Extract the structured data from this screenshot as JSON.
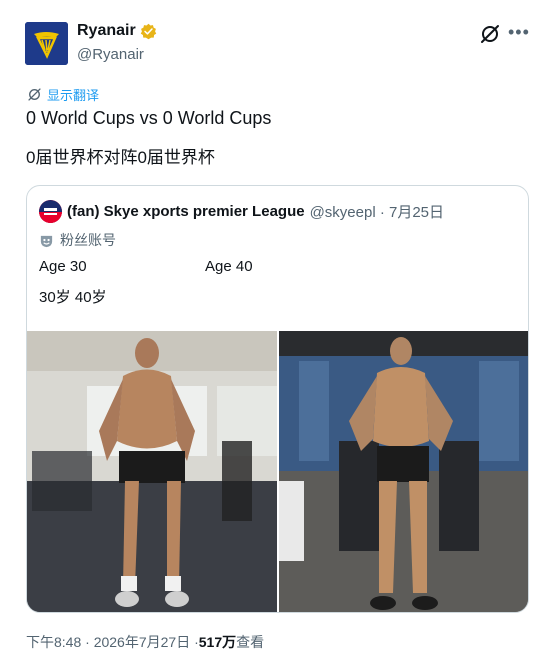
{
  "author": {
    "display_name": "Ryanair",
    "handle": "@Ryanair"
  },
  "translate_label": "显示翻译",
  "tweet": {
    "line1": "0 World Cups vs 0 World Cups",
    "line2": "0届世界杯对阵0届世界杯"
  },
  "quote": {
    "name": "(fan) Skye xports premier League",
    "handle_date": "@skyeepl · 7月25日",
    "fan_label": "粉丝账号",
    "age_left": "Age 30",
    "age_right": "Age 40",
    "ages_cn": "30岁 40岁"
  },
  "footer": {
    "time_date": "下午8:48 · 2026年7月27日 · ",
    "views_count": "517万",
    "views_label": " 查看"
  },
  "colors": {
    "link": "#1d9bf0",
    "secondary_text": "#536471",
    "border": "#cfd9de",
    "verified": "#e8b418",
    "brand_navy": "#1e3a8a"
  },
  "icons": [
    "ryanair-harp-logo",
    "verified-badge-icon",
    "grok-icon",
    "more-icon",
    "translate-icon",
    "sky-sports-logo",
    "fan-account-icon"
  ]
}
